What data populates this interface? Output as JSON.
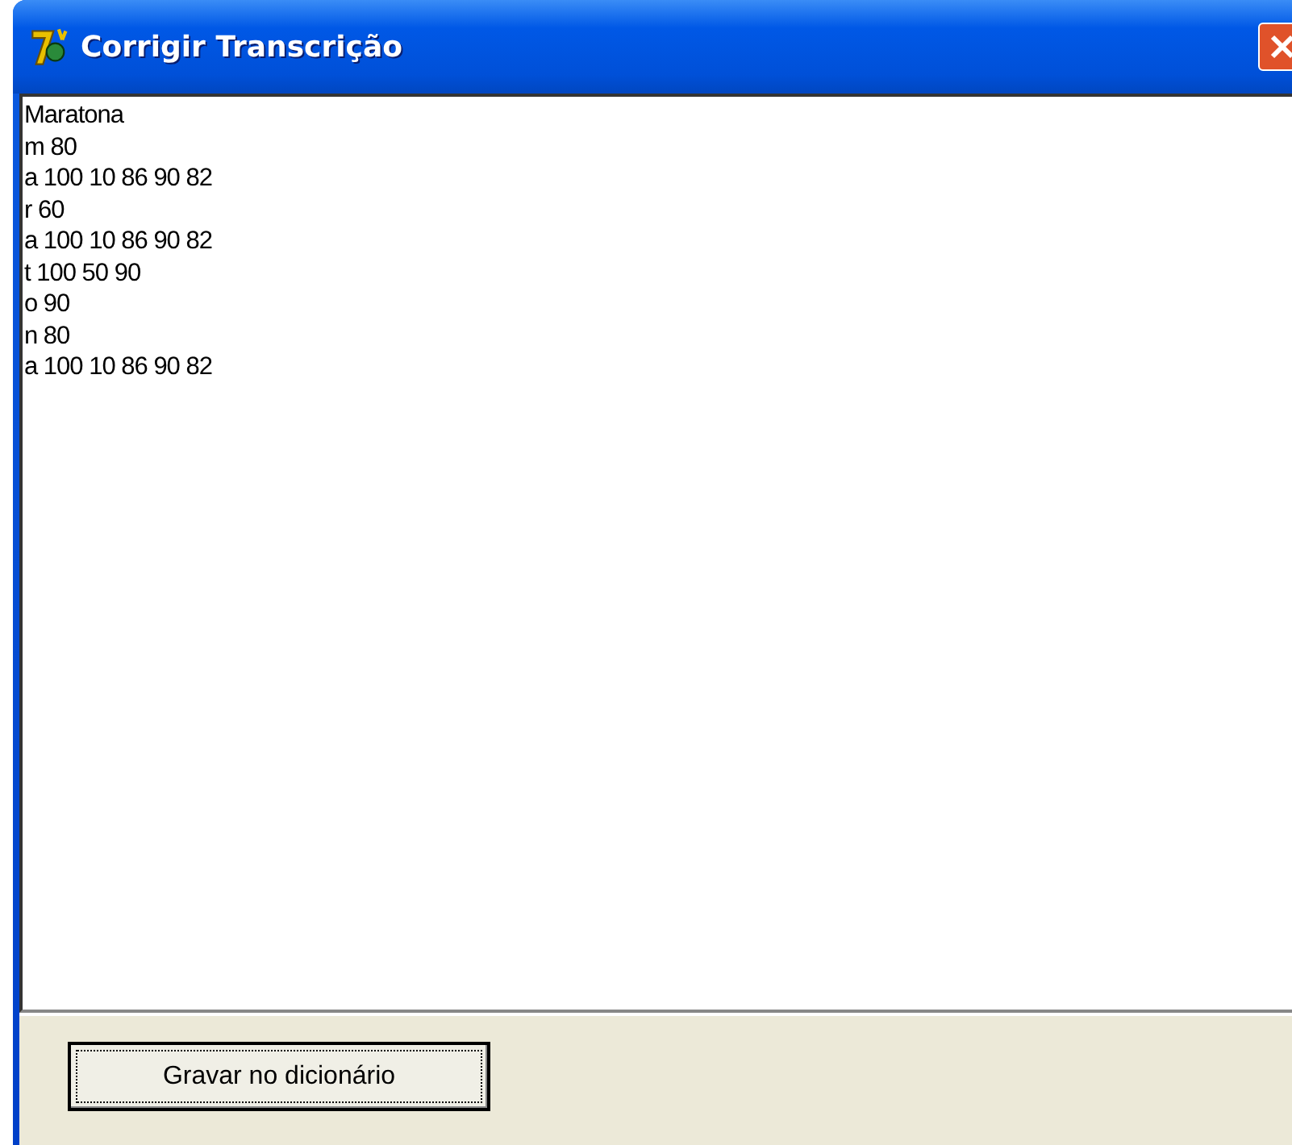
{
  "window": {
    "title": "Corrigir Transcrição"
  },
  "editor": {
    "lines": [
      "Maratona",
      "m 80",
      "a 100 10 86 90 82",
      "r 60",
      "a 100 10 86 90 82",
      "t 100 50 90",
      "o 90",
      "n 80",
      "a 100 10 86 90 82"
    ]
  },
  "buttons": [
    {
      "label": "Gravar no dicionário",
      "focused": true
    }
  ]
}
